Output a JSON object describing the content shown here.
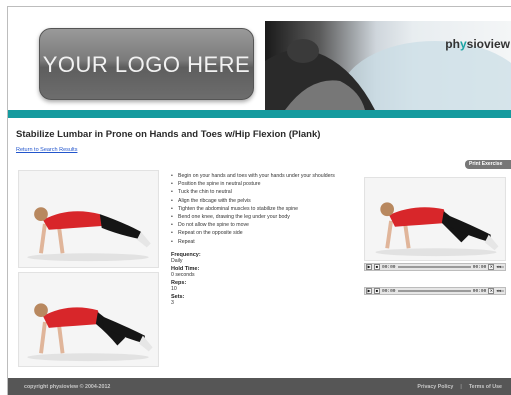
{
  "header": {
    "logo_text": "YOUR LOGO HERE",
    "brand_prefix": "ph",
    "brand_mark": "y",
    "brand_suffix": "sioview"
  },
  "exercise": {
    "title": "Stabilize Lumbar in Prone on Hands and Toes w/Hip Flexion (Plank)",
    "back_link": "Return to Search Results",
    "print_label": "Print Exercise",
    "steps": [
      "Begin on your hands and toes with your hands under your shoulders",
      "Position the spine in neutral posture",
      "Tuck the chin to neutral",
      "Align the ribcage with the pelvis",
      "Tighten the abdominal muscles to stabilize the spine",
      "Bend one knee, drawing the leg under your body",
      "Do not allow the spine to move",
      "Repeat on the opposite side",
      "Repeat"
    ],
    "frequency_label": "Frequency:",
    "frequency": "Daily",
    "hold_label": "Hold Time:",
    "hold": "0 seconds",
    "reps_label": "Reps:",
    "reps": "10",
    "sets_label": "Sets:",
    "sets": "3"
  },
  "players": [
    {
      "current": "00:00",
      "total": "00:00"
    },
    {
      "current": "00:00",
      "total": "00:00"
    }
  ],
  "footer": {
    "copyright": "copyright physioview © 2004-2012",
    "privacy": "Privacy Policy",
    "separator": "|",
    "terms": "Terms of Use"
  },
  "colors": {
    "accent": "#159a9e",
    "footer_bg": "#565656",
    "link": "#2255cc"
  }
}
